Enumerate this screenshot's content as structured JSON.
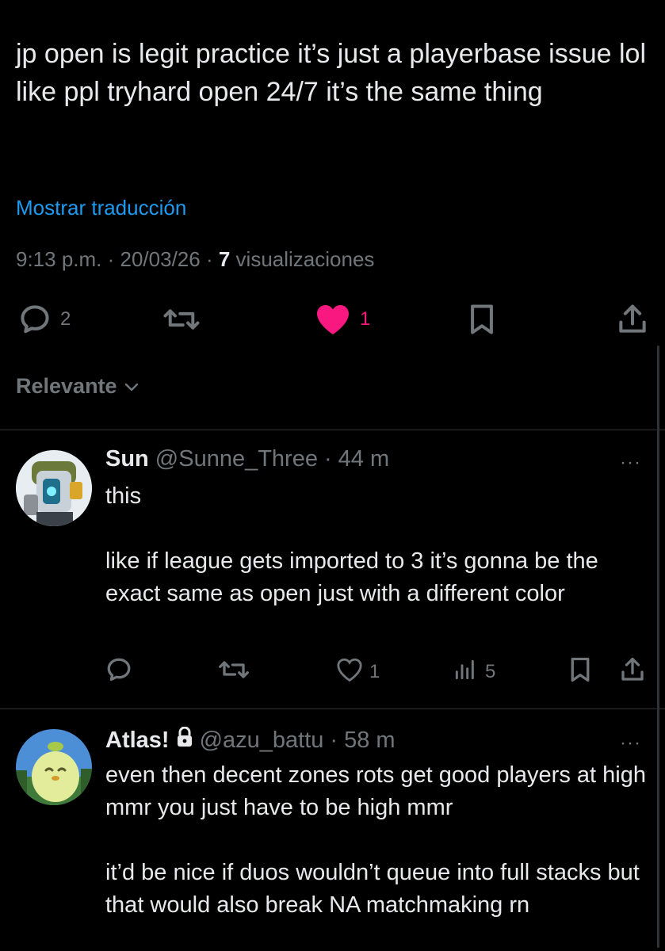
{
  "tweet": {
    "text": "jp open is legit practice it’s just a playerbase issue lol like ppl tryhard open 24/7 it’s the same thing",
    "translate_label": "Mostrar traducción",
    "time": "9:13 p.m.",
    "date": "20/03/26",
    "views_count": "7",
    "views_label": "visualizaciones",
    "sep": " · ",
    "replies": "2",
    "likes": "1",
    "like_color": "#f91880"
  },
  "sort": {
    "label": "Relevante"
  },
  "replies": [
    {
      "name": "Sun",
      "handle": "@Sunne_Three",
      "age": "· 44 m",
      "paragraphs": [
        "this",
        "like if league gets imported to 3 it’s gonna be the exact same as open just with a different color"
      ],
      "likes": "1",
      "views": "5",
      "more": "···"
    },
    {
      "name": "Atlas!",
      "handle": "@azu_battu",
      "age": "· 58 m",
      "locked": true,
      "paragraphs": [
        "even then decent zones rots get good players at high mmr you just have to be high mmr",
        "it’d be nice if duos wouldn’t queue into full stacks but that would also break NA matchmaking rn"
      ],
      "more": "···"
    }
  ],
  "colors": {
    "background": "#000000",
    "text": "#e7e9ea",
    "secondary": "#71767b",
    "link": "#1d9bf0",
    "divider": "#2f3336"
  },
  "icons": [
    "reply-icon",
    "retweet-icon",
    "heart-icon",
    "bookmark-icon",
    "share-icon",
    "views-icon",
    "lock-icon",
    "chevron-down-icon",
    "more-icon"
  ]
}
